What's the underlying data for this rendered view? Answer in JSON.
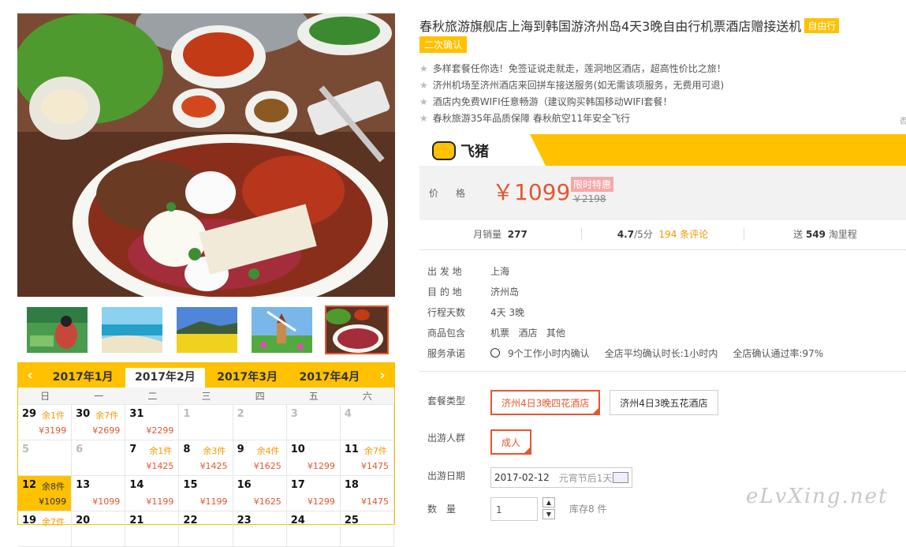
{
  "product": {
    "title": "春秋旅游旗舰店上海到韩国游济州岛4天3晚自由行机票酒店赠接送机",
    "tag": "自由行",
    "tag2": "二次确认",
    "features": [
      "多样套餐任你选！免签证说走就走，莲洞地区酒店，超高性价比之旅！",
      "济州机场至济州酒店来回拼车接送服务(如无需该项服务，无费用可退)",
      "酒店内免费WIFI任意畅游（建议购买韩国移动WIFI套餐！",
      "春秋旅游35年品质保障 春秋航空11年安全飞行"
    ]
  },
  "brand": {
    "name": "飞猪",
    "color": "#ffc100"
  },
  "price": {
    "label": "价格",
    "value": "￥1099",
    "badge": "限时特惠",
    "original": "￥2198"
  },
  "stats": {
    "sales_label": "月销量",
    "sales": "277",
    "rating": "4.7",
    "rating_suffix": "/5分",
    "reviews": "194 条评论",
    "points_prefix": "送",
    "points": "549",
    "points_suffix": "淘里程"
  },
  "info": [
    {
      "label": "出 发 地",
      "value": "上海"
    },
    {
      "label": "目 的 地",
      "value": "济州岛"
    },
    {
      "label": "行程天数",
      "value": "4天 3晚"
    },
    {
      "label": "商品包含",
      "value": "机票   酒店   其他"
    },
    {
      "label": "服务承诺",
      "value": "9个工作小时内确认     全店平均确认时长:1小时内     全店确认通过率:97%"
    }
  ],
  "options": {
    "package_label": "套餐类型",
    "packages": [
      "济州4日3晚四花酒店",
      "济州4日3晚五花酒店"
    ],
    "crowd_label": "出游人群",
    "crowd": "成人",
    "date_label": "出游日期",
    "date_value": "2017-02-12",
    "date_note": "元宵节后1天",
    "qty_label": "数　量",
    "qty_value": "1",
    "stock": "库存8 件"
  },
  "calendar": {
    "months": [
      "2017年1月",
      "2017年2月",
      "2017年3月",
      "2017年4月"
    ],
    "current_month": "2017年2月",
    "weekdays": [
      "日",
      "一",
      "二",
      "三",
      "四",
      "五",
      "六"
    ],
    "days": [
      {
        "d": "29",
        "s": "余1件",
        "p": "¥3199"
      },
      {
        "d": "30",
        "s": "余7件",
        "p": "¥2699"
      },
      {
        "d": "31",
        "s": "",
        "p": "¥2299"
      },
      {
        "d": "1",
        "dim": true
      },
      {
        "d": "2",
        "dim": true
      },
      {
        "d": "3",
        "dim": true
      },
      {
        "d": "4",
        "dim": true
      },
      {
        "d": "5",
        "dim": true
      },
      {
        "d": "6",
        "dim": true
      },
      {
        "d": "7",
        "s": "余1件",
        "p": "¥1425"
      },
      {
        "d": "8",
        "s": "余3件",
        "p": "¥1425"
      },
      {
        "d": "9",
        "s": "余4件",
        "p": "¥1625"
      },
      {
        "d": "10",
        "s": "",
        "p": "¥1299"
      },
      {
        "d": "11",
        "s": "余7件",
        "p": "¥1475"
      },
      {
        "d": "12",
        "s": "余8件",
        "p": "¥1099",
        "sel": true
      },
      {
        "d": "13",
        "s": "",
        "p": "¥1099"
      },
      {
        "d": "14",
        "s": "",
        "p": "¥1199"
      },
      {
        "d": "15",
        "s": "",
        "p": "¥1199"
      },
      {
        "d": "16",
        "s": "",
        "p": "¥1625"
      },
      {
        "d": "17",
        "s": "",
        "p": "¥1299"
      },
      {
        "d": "18",
        "s": "",
        "p": "¥1475"
      },
      {
        "d": "19",
        "s": "余7件",
        "p": ""
      },
      {
        "d": "20",
        "s": "",
        "p": ""
      },
      {
        "d": "21",
        "s": "",
        "p": ""
      },
      {
        "d": "22",
        "s": "",
        "p": ""
      },
      {
        "d": "23",
        "s": "",
        "p": ""
      },
      {
        "d": "24",
        "s": "",
        "p": ""
      },
      {
        "d": "25",
        "s": "",
        "p": ""
      }
    ]
  },
  "watermark": "eLvXing.net",
  "edge_text": "否"
}
